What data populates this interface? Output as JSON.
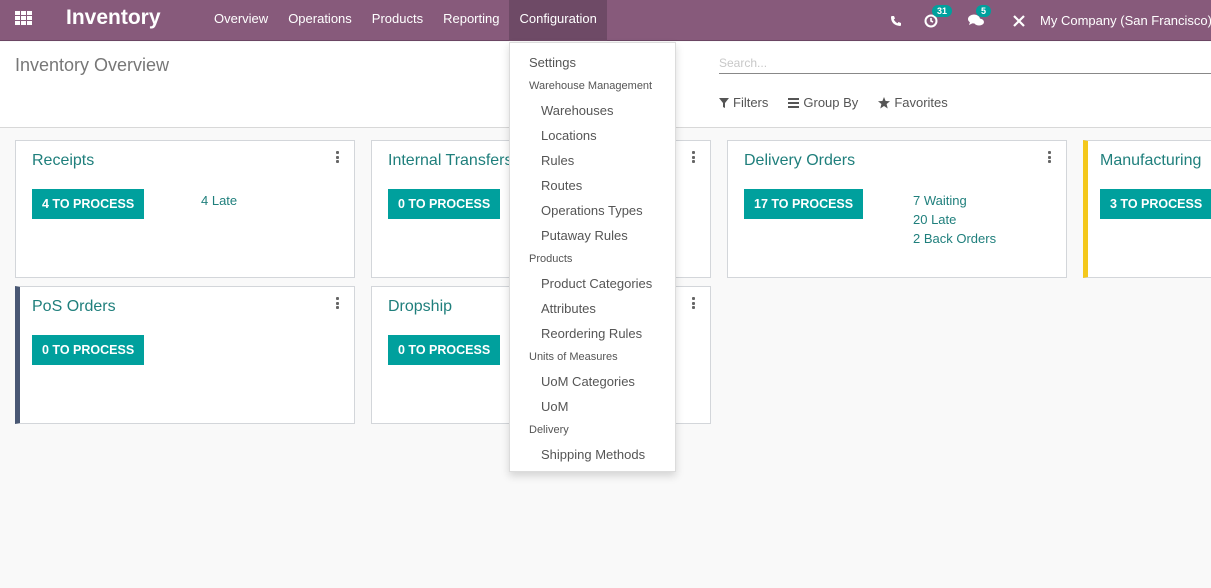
{
  "navbar": {
    "app_title": "Inventory",
    "menu": [
      "Overview",
      "Operations",
      "Products",
      "Reporting",
      "Configuration"
    ],
    "active_menu": "Configuration",
    "activity_count": "31",
    "messages_count": "5",
    "company": "My Company (San Francisco)"
  },
  "control_panel": {
    "title": "Inventory Overview",
    "search_placeholder": "Search...",
    "filters": "Filters",
    "group_by": "Group By",
    "favorites": "Favorites"
  },
  "cards": [
    {
      "title": "Receipts",
      "button": "4 TO PROCESS",
      "stats": [
        "4 Late"
      ]
    },
    {
      "title": "Internal Transfers",
      "button": "0 TO PROCESS",
      "stats": []
    },
    {
      "title": "Delivery Orders",
      "button": "17 TO PROCESS",
      "stats": [
        "7 Waiting",
        "20 Late",
        "2 Back Orders"
      ]
    },
    {
      "title": "Manufacturing",
      "button": "3 TO PROCESS",
      "stats": []
    },
    {
      "title": "PoS Orders",
      "button": "0 TO PROCESS",
      "stats": []
    },
    {
      "title": "Dropship",
      "button": "0 TO PROCESS",
      "stats": []
    }
  ],
  "colors": {
    "navbar": "#875a7b",
    "primary_button": "#00a09d",
    "link": "#1f7f7c",
    "pos_border": "#4a5874",
    "manufacturing_border": "#f4c81c"
  },
  "config_menu": {
    "settings": "Settings",
    "warehouse_header": "Warehouse Management",
    "warehouse_items": [
      "Warehouses",
      "Locations",
      "Rules",
      "Routes",
      "Operations Types",
      "Putaway Rules"
    ],
    "products_header": "Products",
    "products_items": [
      "Product Categories",
      "Attributes",
      "Reordering Rules"
    ],
    "uom_header": "Units of Measures",
    "uom_items": [
      "UoM Categories",
      "UoM"
    ],
    "delivery_header": "Delivery",
    "delivery_items": [
      "Shipping Methods"
    ]
  }
}
